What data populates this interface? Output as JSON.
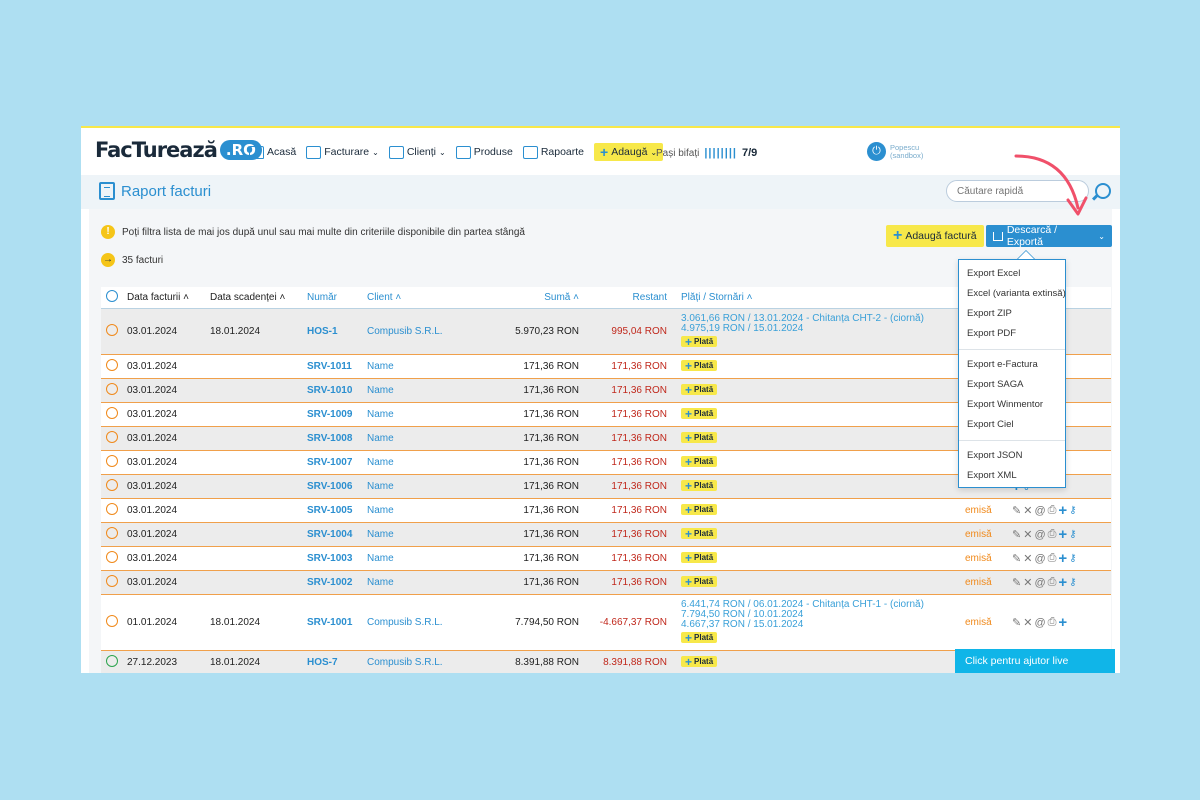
{
  "logo": {
    "main": "FacTurează",
    "badge": ".RO"
  },
  "nav": {
    "items": [
      {
        "label": "Acasă",
        "dropdown": false
      },
      {
        "label": "Facturare",
        "dropdown": true
      },
      {
        "label": "Clienți",
        "dropdown": true
      },
      {
        "label": "Produse",
        "dropdown": false
      },
      {
        "label": "Rapoarte",
        "dropdown": false
      }
    ],
    "add_label": "Adaugă",
    "steps_label": "Pași bifați",
    "steps_bars": "||||||||",
    "steps_count": "7/9"
  },
  "user": {
    "name": "Popescu",
    "env": "(sandbox)"
  },
  "page": {
    "title": "Raport facturi"
  },
  "search": {
    "placeholder": "Căutare rapidă"
  },
  "info": {
    "message": "Poți filtra lista de mai jos după unul sau mai multe din criteriile disponibile din partea stângă",
    "count": "35 facturi"
  },
  "actions": {
    "add_invoice": "Adaugă factură",
    "export": "Descarcă / Exportă"
  },
  "table": {
    "headers": {
      "date": "Data facturii",
      "due": "Data scadenței",
      "number": "Număr",
      "client": "Client",
      "sum": "Sumă",
      "rest": "Restant",
      "payments": "Plăți / Stornări"
    },
    "pay_label": "Plată",
    "rows": [
      {
        "date": "03.01.2024",
        "due": "18.01.2024",
        "number": "HOS-1",
        "client": "Compusib S.R.L.",
        "sum": "5.970,23 RON",
        "rest": "995,04 RON",
        "payments": [
          "3.061,66 RON / 13.01.2024 - Chitanța CHT-2 - (ciornă)",
          "4.975,19 RON / 15.01.2024"
        ],
        "status": ""
      },
      {
        "date": "03.01.2024",
        "due": "",
        "number": "SRV-1011",
        "client": "Name",
        "sum": "171,36 RON",
        "rest": "171,36 RON",
        "payments": [],
        "status": ""
      },
      {
        "date": "03.01.2024",
        "due": "",
        "number": "SRV-1010",
        "client": "Name",
        "sum": "171,36 RON",
        "rest": "171,36 RON",
        "payments": [],
        "status": ""
      },
      {
        "date": "03.01.2024",
        "due": "",
        "number": "SRV-1009",
        "client": "Name",
        "sum": "171,36 RON",
        "rest": "171,36 RON",
        "payments": [],
        "status": ""
      },
      {
        "date": "03.01.2024",
        "due": "",
        "number": "SRV-1008",
        "client": "Name",
        "sum": "171,36 RON",
        "rest": "171,36 RON",
        "payments": [],
        "status": ""
      },
      {
        "date": "03.01.2024",
        "due": "",
        "number": "SRV-1007",
        "client": "Name",
        "sum": "171,36 RON",
        "rest": "171,36 RON",
        "payments": [],
        "status": ""
      },
      {
        "date": "03.01.2024",
        "due": "",
        "number": "SRV-1006",
        "client": "Name",
        "sum": "171,36 RON",
        "rest": "171,36 RON",
        "payments": [],
        "status": ""
      },
      {
        "date": "03.01.2024",
        "due": "",
        "number": "SRV-1005",
        "client": "Name",
        "sum": "171,36 RON",
        "rest": "171,36 RON",
        "payments": [],
        "status": "emisă"
      },
      {
        "date": "03.01.2024",
        "due": "",
        "number": "SRV-1004",
        "client": "Name",
        "sum": "171,36 RON",
        "rest": "171,36 RON",
        "payments": [],
        "status": "emisă"
      },
      {
        "date": "03.01.2024",
        "due": "",
        "number": "SRV-1003",
        "client": "Name",
        "sum": "171,36 RON",
        "rest": "171,36 RON",
        "payments": [],
        "status": "emisă"
      },
      {
        "date": "03.01.2024",
        "due": "",
        "number": "SRV-1002",
        "client": "Name",
        "sum": "171,36 RON",
        "rest": "171,36 RON",
        "payments": [],
        "status": "emisă"
      },
      {
        "date": "01.01.2024",
        "due": "18.01.2024",
        "number": "SRV-1001",
        "client": "Compusib S.R.L.",
        "sum": "7.794,50 RON",
        "rest": "-4.667,37 RON",
        "payments": [
          "6.441,74 RON / 06.01.2024 - Chitanța CHT-1 - (ciornă)",
          "7.794,50 RON / 10.01.2024",
          "4.667,37 RON / 15.01.2024"
        ],
        "status": "emisă"
      },
      {
        "date": "27.12.2023",
        "due": "18.01.2024",
        "number": "HOS-7",
        "client": "Compusib S.R.L.",
        "sum": "8.391,88 RON",
        "rest": "8.391,88 RON",
        "payments": [],
        "status": ""
      }
    ]
  },
  "export_menu": {
    "items": [
      "Export Excel",
      "Excel (varianta extinsă)",
      "Export ZIP",
      "Export PDF",
      "Export e-Factura",
      "Export SAGA",
      "Export Winmentor",
      "Export Ciel",
      "Export JSON",
      "Export XML"
    ]
  },
  "help": {
    "label": "Click pentru ajutor live"
  },
  "colors": {
    "accent": "#2b8fd0",
    "yellow": "#f7e84a",
    "orange": "#f08a1c",
    "red": "#c0281c",
    "background": "#aedff2"
  }
}
